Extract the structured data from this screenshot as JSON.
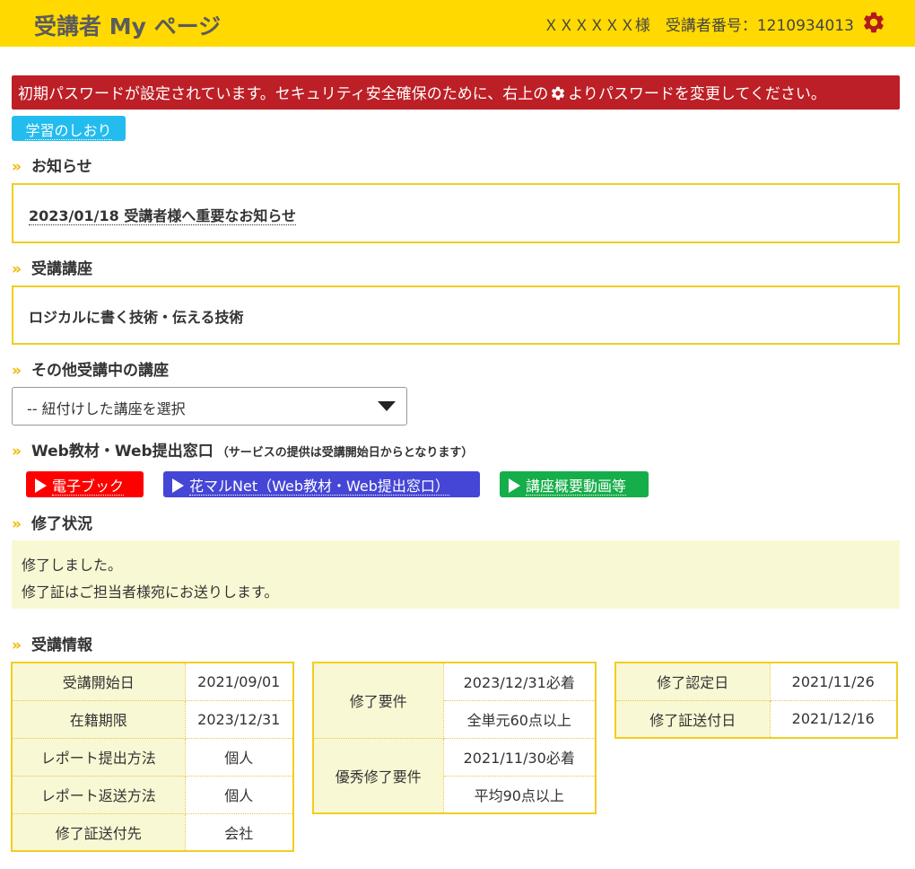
{
  "header": {
    "title": "受講者 My ページ",
    "user_text": "ＸＸＸＸＸＸ様　受講者番号：1210934013",
    "gear_color": "#b3181f"
  },
  "alert": {
    "text_before": "初期パスワードが設定されています。セキュリティ安全確保のために、右上の",
    "text_after": "よりパスワードを変更してください。"
  },
  "bookmark_button": "学習のしおり",
  "sections": {
    "news": "お知らせ",
    "course": "受講講座",
    "other_courses": "その他受講中の講座",
    "web": "Web教材・Web提出窓口",
    "web_note": "（サービスの提供は受講開始日からとなります）",
    "completion": "修了状況",
    "info": "受講情報"
  },
  "news_item": "2023/01/18 受講者様へ重要なお知らせ",
  "course_name": "ロジカルに書く技術・伝える技術",
  "other_courses_select": "-- 紐付けした講座を選択",
  "web_buttons": [
    {
      "label": "電子ブック",
      "color": "#ff0000"
    },
    {
      "label": "花マルNet（Web教材・Web提出窓口）",
      "color": "#4546d6"
    },
    {
      "label": "講座概要動画等",
      "color": "#16ae4a"
    }
  ],
  "completion_status": {
    "line1": "修了しました。",
    "line2": "修了証はご担当者様宛にお送りします。"
  },
  "info_table1": [
    {
      "label": "受講開始日",
      "value": "2021/09/01"
    },
    {
      "label": "在籍期限",
      "value": "2023/12/31"
    },
    {
      "label": "レポート提出方法",
      "value": "個人"
    },
    {
      "label": "レポート返送方法",
      "value": "個人"
    },
    {
      "label": "修了証送付先",
      "value": "会社"
    }
  ],
  "info_table2": [
    {
      "label": "修了要件",
      "values": [
        "2023/12/31必着",
        "全単元60点以上"
      ]
    },
    {
      "label": "優秀修了要件",
      "values": [
        "2021/11/30必着",
        "平均90点以上"
      ]
    }
  ],
  "info_table3": [
    {
      "label": "修了認定日",
      "value": "2021/11/26"
    },
    {
      "label": "修了証送付日",
      "value": "2021/12/16"
    }
  ]
}
